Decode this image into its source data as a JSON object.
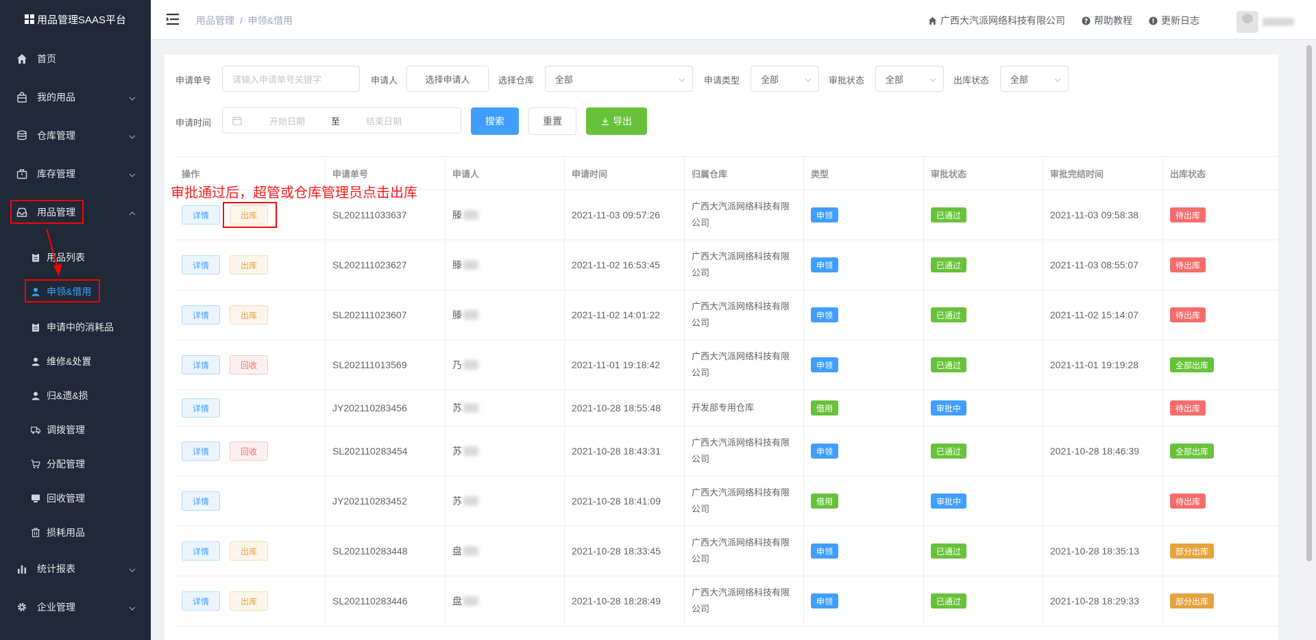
{
  "sidebar": {
    "brand": "用品管理SAAS平台",
    "menu": [
      {
        "label": "首页",
        "icon": "home-icon"
      },
      {
        "label": "我的用品",
        "icon": "bag-icon"
      },
      {
        "label": "仓库管理",
        "icon": "database-icon"
      },
      {
        "label": "库存管理",
        "icon": "briefcase-icon"
      },
      {
        "label": "用品管理",
        "icon": "inbox-icon"
      },
      {
        "label": "统计报表",
        "icon": "bar-chart-icon"
      },
      {
        "label": "企业管理",
        "icon": "gear-icon"
      }
    ],
    "submenu": [
      {
        "label": "用品列表",
        "icon": "clipboard-icon"
      },
      {
        "label": "申领&借用",
        "icon": "user-icon"
      },
      {
        "label": "申请中的消耗品",
        "icon": "clipboard-icon"
      },
      {
        "label": "维修&处置",
        "icon": "user-icon"
      },
      {
        "label": "归&遗&损",
        "icon": "user-icon"
      },
      {
        "label": "调拨管理",
        "icon": "truck-icon"
      },
      {
        "label": "分配管理",
        "icon": "cart-icon"
      },
      {
        "label": "回收管理",
        "icon": "monitor-icon"
      },
      {
        "label": "损耗用品",
        "icon": "trash-icon"
      }
    ]
  },
  "header": {
    "breadcrumb_parent": "用品管理",
    "breadcrumb_sep": "/",
    "breadcrumb_current": "申领&借用",
    "company": "广西大汽派网络科技有限公司",
    "help": "帮助教程",
    "changelog": "更新日志"
  },
  "filters": {
    "apply_no_label": "申请单号",
    "apply_no_placeholder": "请输入申请单号关键字",
    "applicant_label": "申请人",
    "applicant_button": "选择申请人",
    "warehouse_label": "选择仓库",
    "warehouse_value": "全部",
    "type_label": "申请类型",
    "type_value": "全部",
    "approval_label": "审批状态",
    "approval_value": "全部",
    "outbound_label": "出库状态",
    "outbound_value": "全部",
    "time_label": "申请时间",
    "start_placeholder": "开始日期",
    "range_sep": "至",
    "end_placeholder": "结束日期",
    "search_button": "搜索",
    "reset_button": "重置",
    "export_button": "导出"
  },
  "table": {
    "columns": [
      "操作",
      "申请单号",
      "申请人",
      "申请时间",
      "归属仓库",
      "类型",
      "审批状态",
      "审批完结时间",
      "出库状态"
    ],
    "rows": [
      {
        "actions": [
          "详情",
          "出库"
        ],
        "action_kinds": [
          "info",
          "warn"
        ],
        "no": "SL202111033637",
        "applicant": "滕",
        "time": "2021-11-03 09:57:26",
        "warehouse": "广西大汽派网络科技有限公司",
        "type": "申领",
        "type_color": "blue",
        "approval": "已通过",
        "approval_color": "green",
        "done_time": "2021-11-03 09:58:38",
        "outbound": "待出库",
        "outbound_color": "red"
      },
      {
        "actions": [
          "详情",
          "出库"
        ],
        "action_kinds": [
          "info",
          "warn"
        ],
        "no": "SL202111023627",
        "applicant": "滕",
        "time": "2021-11-02 16:53:45",
        "warehouse": "广西大汽派网络科技有限公司",
        "type": "申领",
        "type_color": "blue",
        "approval": "已通过",
        "approval_color": "green",
        "done_time": "2021-11-03 08:55:07",
        "outbound": "待出库",
        "outbound_color": "red"
      },
      {
        "actions": [
          "详情",
          "出库"
        ],
        "action_kinds": [
          "info",
          "warn"
        ],
        "no": "SL202111023607",
        "applicant": "滕",
        "time": "2021-11-02 14:01:22",
        "warehouse": "广西大汽派网络科技有限公司",
        "type": "申领",
        "type_color": "blue",
        "approval": "已通过",
        "approval_color": "green",
        "done_time": "2021-11-02 15:14:07",
        "outbound": "待出库",
        "outbound_color": "red"
      },
      {
        "actions": [
          "详情",
          "回收"
        ],
        "action_kinds": [
          "info",
          "danger"
        ],
        "no": "SL202111013569",
        "applicant": "乃",
        "time": "2021-11-01 19:18:42",
        "warehouse": "广西大汽派网络科技有限公司",
        "type": "申领",
        "type_color": "blue",
        "approval": "已通过",
        "approval_color": "green",
        "done_time": "2021-11-01 19:19:28",
        "outbound": "全部出库",
        "outbound_color": "green"
      },
      {
        "actions": [
          "详情"
        ],
        "action_kinds": [
          "info"
        ],
        "no": "JY202110283456",
        "applicant": "苏",
        "time": "2021-10-28 18:55:48",
        "warehouse": "开发部专用仓库",
        "type": "借用",
        "type_color": "green",
        "approval": "审批中",
        "approval_color": "blue",
        "done_time": "",
        "outbound": "待出库",
        "outbound_color": "red"
      },
      {
        "actions": [
          "详情",
          "回收"
        ],
        "action_kinds": [
          "info",
          "danger"
        ],
        "no": "SL202110283454",
        "applicant": "苏",
        "time": "2021-10-28 18:43:31",
        "warehouse": "广西大汽派网络科技有限公司",
        "type": "申领",
        "type_color": "blue",
        "approval": "已通过",
        "approval_color": "green",
        "done_time": "2021-10-28 18:46:39",
        "outbound": "全部出库",
        "outbound_color": "green"
      },
      {
        "actions": [
          "详情"
        ],
        "action_kinds": [
          "info"
        ],
        "no": "JY202110283452",
        "applicant": "苏",
        "time": "2021-10-28 18:41:09",
        "warehouse": "广西大汽派网络科技有限公司",
        "type": "借用",
        "type_color": "green",
        "approval": "审批中",
        "approval_color": "blue",
        "done_time": "",
        "outbound": "待出库",
        "outbound_color": "red"
      },
      {
        "actions": [
          "详情",
          "出库"
        ],
        "action_kinds": [
          "info",
          "warn"
        ],
        "no": "SL202110283448",
        "applicant": "盘",
        "time": "2021-10-28 18:33:45",
        "warehouse": "广西大汽派网络科技有限公司",
        "type": "申领",
        "type_color": "blue",
        "approval": "已通过",
        "approval_color": "green",
        "done_time": "2021-10-28 18:35:13",
        "outbound": "部分出库",
        "outbound_color": "orange"
      },
      {
        "actions": [
          "详情",
          "出库"
        ],
        "action_kinds": [
          "info",
          "warn"
        ],
        "no": "SL202110283446",
        "applicant": "盘",
        "time": "2021-10-28 18:28:49",
        "warehouse": "广西大汽派网络科技有限公司",
        "type": "申领",
        "type_color": "blue",
        "approval": "已通过",
        "approval_color": "green",
        "done_time": "2021-10-28 18:29:33",
        "outbound": "部分出库",
        "outbound_color": "orange"
      }
    ]
  },
  "annotation": {
    "text": "审批通过后，超管或仓库管理员点击出库"
  },
  "colors": {
    "sidebar_bg": "#1f2937",
    "primary": "#409eff",
    "success": "#67c23a",
    "danger": "#f56c6c",
    "warning": "#e6a23c",
    "annotation": "#ff0000"
  }
}
